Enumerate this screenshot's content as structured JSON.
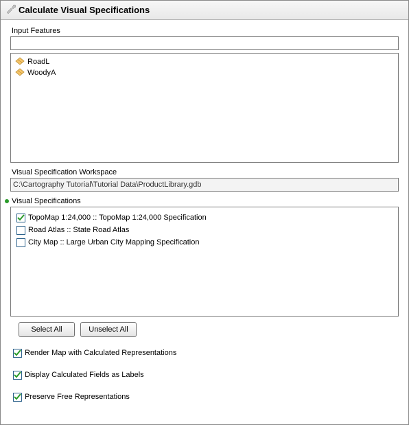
{
  "window": {
    "title": "Calculate Visual Specifications"
  },
  "input_features": {
    "label": "Input Features",
    "items": [
      {
        "name": "RoadL"
      },
      {
        "name": "WoodyA"
      }
    ]
  },
  "workspace": {
    "label": "Visual Specification Workspace",
    "path": "C:\\Cartography Tutorial\\Tutorial Data\\ProductLibrary.gdb"
  },
  "visual_specs": {
    "label": "Visual Specifications",
    "items": [
      {
        "label": "TopoMap 1:24,000 :: TopoMap 1:24,000 Specification",
        "checked": true
      },
      {
        "label": "Road Atlas :: State Road Atlas",
        "checked": false
      },
      {
        "label": "City Map :: Large Urban City Mapping Specification",
        "checked": false
      }
    ]
  },
  "buttons": {
    "select_all": "Select All",
    "unselect_all": "Unselect All"
  },
  "options": [
    {
      "label": "Render Map with Calculated Representations",
      "checked": true
    },
    {
      "label": "Display Calculated Fields as Labels",
      "checked": true
    },
    {
      "label": "Preserve Free Representations",
      "checked": true
    }
  ]
}
